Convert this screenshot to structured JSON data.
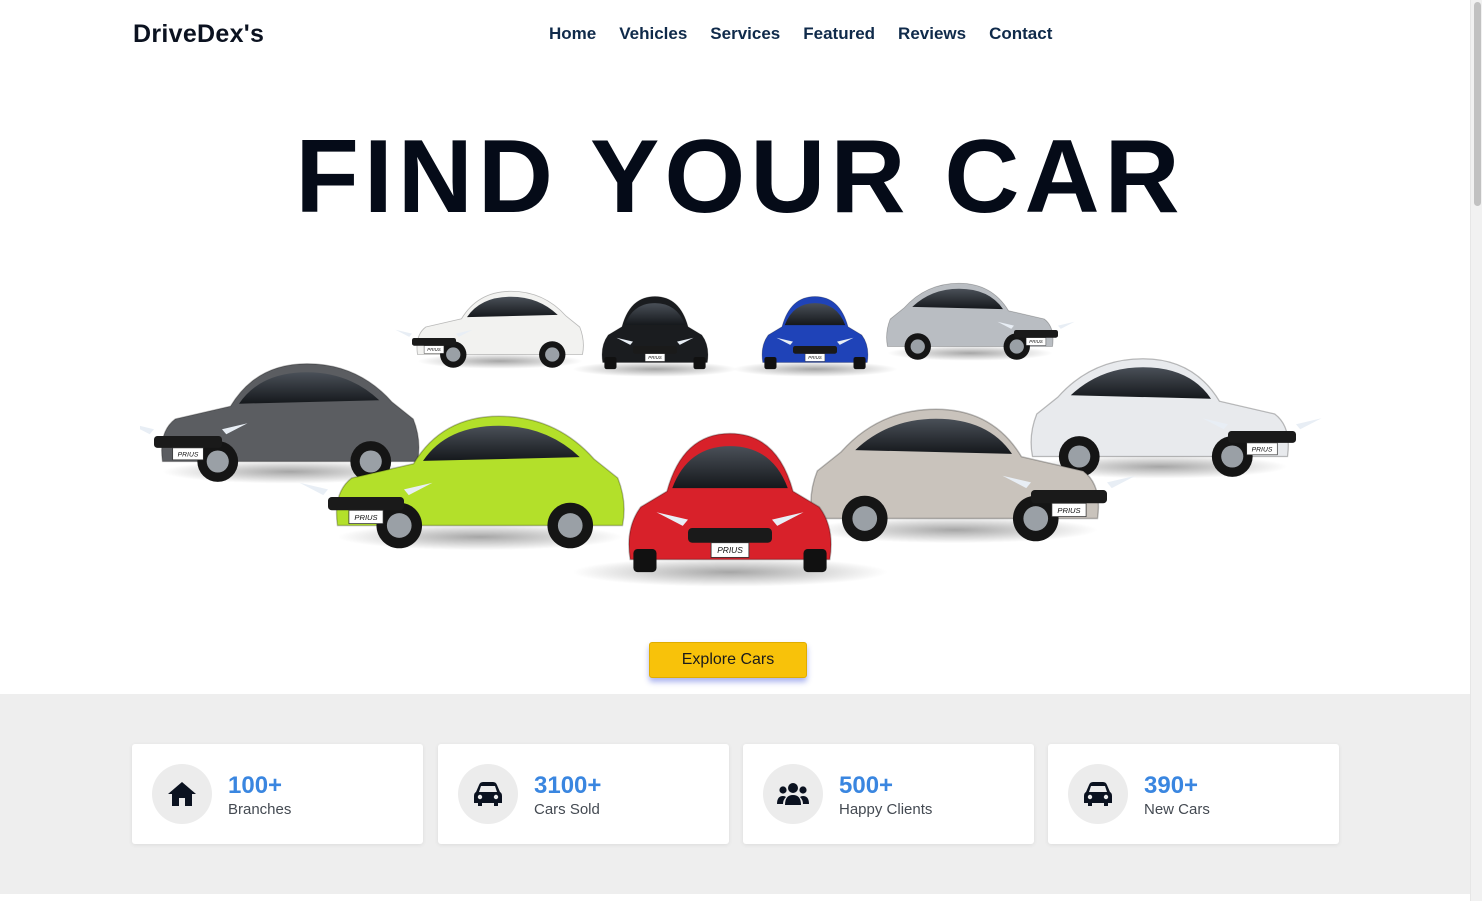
{
  "brand": {
    "name": "DriveDex's"
  },
  "nav": {
    "items": [
      {
        "label": "Home"
      },
      {
        "label": "Vehicles"
      },
      {
        "label": "Services"
      },
      {
        "label": "Featured"
      },
      {
        "label": "Reviews"
      },
      {
        "label": "Contact"
      }
    ]
  },
  "hero": {
    "title": "FIND YOUR CAR",
    "cta_label": "Explore Cars",
    "car_plate_text": "PRIUS",
    "car_colors": [
      "#5b5d61",
      "#f2f2f0",
      "#1a1c1f",
      "#1f43b8",
      "#b9bdc2",
      "#e8eaed",
      "#b3e02a",
      "#d8212a",
      "#c9c3bc"
    ]
  },
  "stats": [
    {
      "value": "100+",
      "label": "Branches",
      "icon": "home-icon"
    },
    {
      "value": "3100+",
      "label": "Cars Sold",
      "icon": "car-icon"
    },
    {
      "value": "500+",
      "label": "Happy Clients",
      "icon": "users-icon"
    },
    {
      "value": "390+",
      "label": "New Cars",
      "icon": "car-icon"
    }
  ],
  "colors": {
    "accent_number": "#3a86e0",
    "cta_background": "#f8c20a",
    "nav_text": "#0f2a4a",
    "stats_background": "#eeeeee"
  }
}
